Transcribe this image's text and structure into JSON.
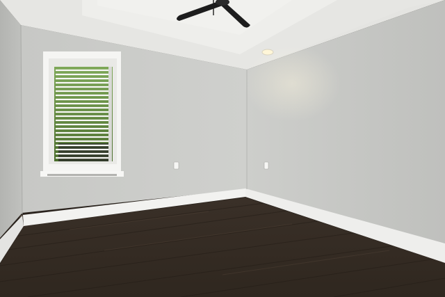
{
  "scene": {
    "description_free": true,
    "colors": {
      "ceiling": "#e6e6e3",
      "tray_ceiling": "#eeeeeb",
      "back_wall": "#c9cac7",
      "right_wall": "#c3c4c1",
      "left_wall": "#b9bab7",
      "baseboard": "#f2f2f0",
      "floor_dark": "#2c241e",
      "floor_mid": "#3f342b",
      "window_frame": "#f5f5f3",
      "foliage": "#5f8a3c",
      "fan_blade": "#1d1d1d",
      "light": "#fff6d8"
    }
  }
}
